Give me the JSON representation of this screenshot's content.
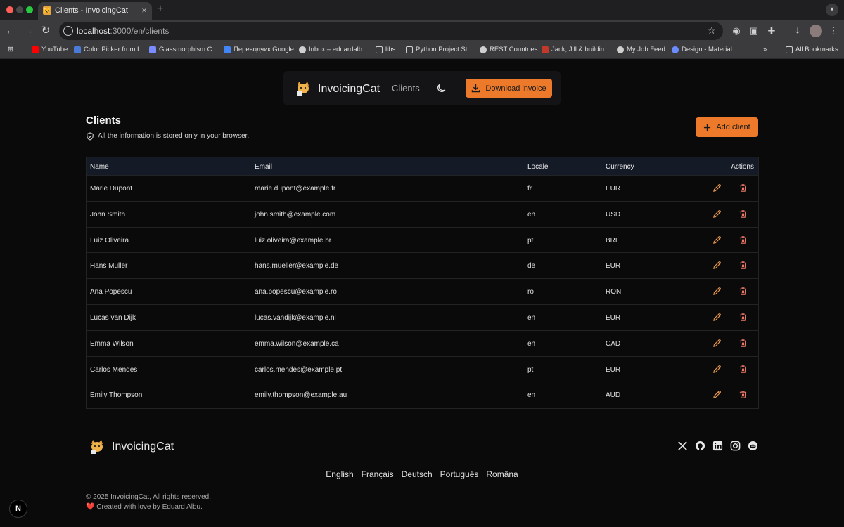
{
  "browser": {
    "tab_title": "Clients - InvoicingCat",
    "tab_close": "×",
    "new_tab": "+",
    "url_host": "localhost",
    "url_path": ":3000/en/clients",
    "bookmarks": [
      {
        "label": "YouTube",
        "icon": "youtube-icon",
        "color": "#ff0000"
      },
      {
        "label": "Color Picker from I...",
        "icon": "color-picker-icon",
        "color": "#4a7bd8"
      },
      {
        "label": "Glassmorphism C...",
        "icon": "glassmorphism-icon",
        "color": "#7a8cff"
      },
      {
        "label": "Переводчик Google",
        "icon": "google-translate-icon",
        "color": "#4285f4"
      },
      {
        "label": "Inbox – eduardalb...",
        "icon": "globe-icon",
        "color": "#cfcfcf"
      },
      {
        "label": "libs",
        "icon": "folder-icon",
        "color": "#cfcfcf"
      },
      {
        "label": "Python Project St...",
        "icon": "folder-icon",
        "color": "#cfcfcf"
      },
      {
        "label": "REST Countries",
        "icon": "globe-icon",
        "color": "#cfcfcf"
      },
      {
        "label": "Jack, Jill & buildin...",
        "icon": "site-icon",
        "color": "#c0392b"
      },
      {
        "label": "My Job Feed",
        "icon": "globe-icon",
        "color": "#cfcfcf"
      },
      {
        "label": "Design - Material...",
        "icon": "material-icon",
        "color": "#6b8cff"
      }
    ],
    "bookmarks_overflow": "»",
    "all_bookmarks": "All Bookmarks"
  },
  "header": {
    "brand": "InvoicingCat",
    "nav_clients": "Clients",
    "download_label": "Download invoice"
  },
  "page": {
    "title": "Clients",
    "info": "All the information is stored only in your browser.",
    "add_client_label": "Add client"
  },
  "table": {
    "columns": [
      "Name",
      "Email",
      "Locale",
      "Currency",
      "Actions"
    ],
    "rows": [
      {
        "name": "Marie Dupont",
        "email": "marie.dupont@example.fr",
        "locale": "fr",
        "currency": "EUR"
      },
      {
        "name": "John Smith",
        "email": "john.smith@example.com",
        "locale": "en",
        "currency": "USD"
      },
      {
        "name": "Luiz Oliveira",
        "email": "luiz.oliveira@example.br",
        "locale": "pt",
        "currency": "BRL"
      },
      {
        "name": "Hans Müller",
        "email": "hans.mueller@example.de",
        "locale": "de",
        "currency": "EUR"
      },
      {
        "name": "Ana Popescu",
        "email": "ana.popescu@example.ro",
        "locale": "ro",
        "currency": "RON"
      },
      {
        "name": "Lucas van Dijk",
        "email": "lucas.vandijk@example.nl",
        "locale": "en",
        "currency": "EUR"
      },
      {
        "name": "Emma Wilson",
        "email": "emma.wilson@example.ca",
        "locale": "en",
        "currency": "CAD"
      },
      {
        "name": "Carlos Mendes",
        "email": "carlos.mendes@example.pt",
        "locale": "pt",
        "currency": "EUR"
      },
      {
        "name": "Emily Thompson",
        "email": "emily.thompson@example.au",
        "locale": "en",
        "currency": "AUD"
      }
    ]
  },
  "footer": {
    "brand": "InvoicingCat",
    "socials": [
      "x-icon",
      "github-icon",
      "linkedin-icon",
      "instagram-icon",
      "reddit-icon"
    ],
    "languages": [
      "English",
      "Français",
      "Deutsch",
      "Português",
      "Româna"
    ],
    "copyright": "© 2025 InvoicingCat, All rights reserved.",
    "credit": "❤️ Created with love by Eduard Albu."
  },
  "next_badge": "N",
  "colors": {
    "accent": "#ed7a2b",
    "background": "#0a0a0b",
    "table_header": "#141a26"
  }
}
